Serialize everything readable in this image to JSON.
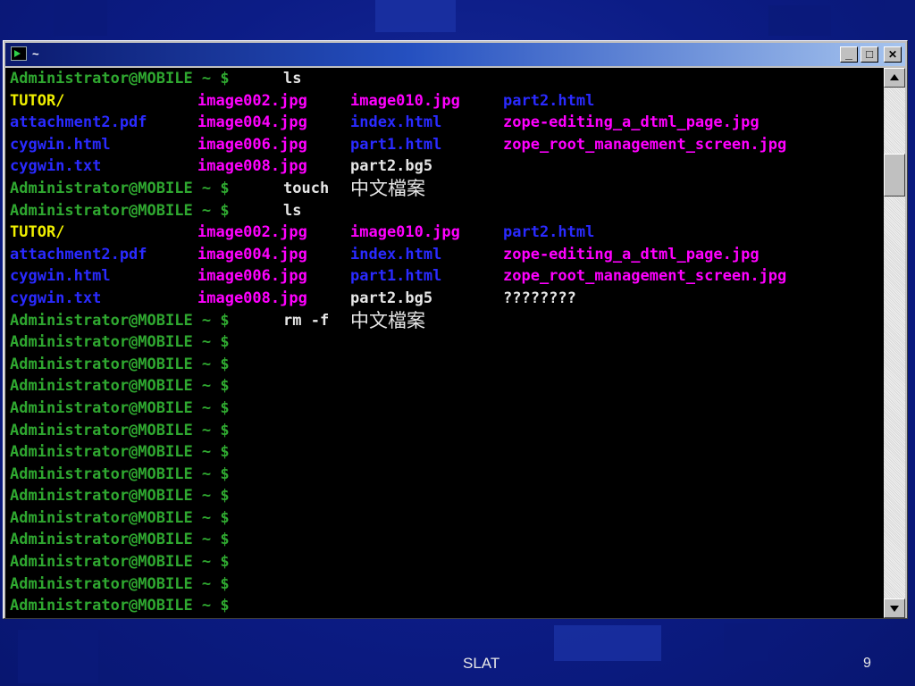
{
  "window": {
    "title": "~",
    "minimize": "_",
    "maximize": "□",
    "close": "✕"
  },
  "icons": {
    "app": "terminal-icon",
    "minimize": "minimize-icon",
    "maximize": "maximize-icon",
    "close": "close-icon",
    "scroll_up": "arrow-up-icon",
    "scroll_down": "arrow-down-icon"
  },
  "colors": {
    "prompt": "#2fa830",
    "directory": "#f0f000",
    "image": "#ff00ff",
    "text_file": "#2a2aff",
    "plain": "#e6e6e6"
  },
  "terminal": {
    "lines": [
      [
        {
          "t": "Administrator@MOBILE ~ $",
          "c": "prompt",
          "col": 0
        },
        {
          "t": "ls",
          "c": "plain",
          "col": 1
        }
      ],
      [
        {
          "t": "TUTOR/",
          "c": "directory",
          "col": 0
        },
        {
          "t": "image002.jpg",
          "c": "image",
          "col": 1
        },
        {
          "t": "image010.jpg",
          "c": "image",
          "col": 2
        },
        {
          "t": "part2.html",
          "c": "text_file",
          "col": 3
        }
      ],
      [
        {
          "t": "attachment2.pdf",
          "c": "text_file",
          "col": 0
        },
        {
          "t": "image004.jpg",
          "c": "image",
          "col": 1
        },
        {
          "t": "index.html",
          "c": "text_file",
          "col": 2
        },
        {
          "t": "zope-editing_a_dtml_page.jpg",
          "c": "image",
          "col": 3
        }
      ],
      [
        {
          "t": "cygwin.html",
          "c": "text_file",
          "col": 0
        },
        {
          "t": "image006.jpg",
          "c": "image",
          "col": 1
        },
        {
          "t": "part1.html",
          "c": "text_file",
          "col": 2
        },
        {
          "t": "zope_root_management_screen.jpg",
          "c": "image",
          "col": 3
        }
      ],
      [
        {
          "t": "cygwin.txt",
          "c": "text_file",
          "col": 0
        },
        {
          "t": "image008.jpg",
          "c": "image",
          "col": 1
        },
        {
          "t": "part2.bg5",
          "c": "plain",
          "col": 2
        }
      ],
      [
        {
          "t": "Administrator@MOBILE ~ $",
          "c": "prompt",
          "col": 0
        },
        {
          "t": "touch",
          "c": "plain",
          "col": 1
        },
        {
          "t": "中文檔案",
          "c": "plain",
          "col": 2,
          "cjk": true
        }
      ],
      [
        {
          "t": "Administrator@MOBILE ~ $",
          "c": "prompt",
          "col": 0
        },
        {
          "t": "ls",
          "c": "plain",
          "col": 1
        }
      ],
      [
        {
          "t": "TUTOR/",
          "c": "directory",
          "col": 0
        },
        {
          "t": "image002.jpg",
          "c": "image",
          "col": 1
        },
        {
          "t": "image010.jpg",
          "c": "image",
          "col": 2
        },
        {
          "t": "part2.html",
          "c": "text_file",
          "col": 3
        }
      ],
      [
        {
          "t": "attachment2.pdf",
          "c": "text_file",
          "col": 0
        },
        {
          "t": "image004.jpg",
          "c": "image",
          "col": 1
        },
        {
          "t": "index.html",
          "c": "text_file",
          "col": 2
        },
        {
          "t": "zope-editing_a_dtml_page.jpg",
          "c": "image",
          "col": 3
        }
      ],
      [
        {
          "t": "cygwin.html",
          "c": "text_file",
          "col": 0
        },
        {
          "t": "image006.jpg",
          "c": "image",
          "col": 1
        },
        {
          "t": "part1.html",
          "c": "text_file",
          "col": 2
        },
        {
          "t": "zope_root_management_screen.jpg",
          "c": "image",
          "col": 3
        }
      ],
      [
        {
          "t": "cygwin.txt",
          "c": "text_file",
          "col": 0
        },
        {
          "t": "image008.jpg",
          "c": "image",
          "col": 1
        },
        {
          "t": "part2.bg5",
          "c": "plain",
          "col": 2
        },
        {
          "t": "????????",
          "c": "plain",
          "col": 3
        }
      ],
      [
        {
          "t": "Administrator@MOBILE ~ $",
          "c": "prompt",
          "col": 0
        },
        {
          "t": "rm -f",
          "c": "plain",
          "col": 1
        },
        {
          "t": "中文檔案",
          "c": "plain",
          "col": 2,
          "cjk": true
        }
      ],
      [
        {
          "t": "Administrator@MOBILE ~ $",
          "c": "prompt",
          "col": 0
        }
      ],
      [
        {
          "t": "Administrator@MOBILE ~ $",
          "c": "prompt",
          "col": 0
        }
      ],
      [
        {
          "t": "Administrator@MOBILE ~ $",
          "c": "prompt",
          "col": 0
        }
      ],
      [
        {
          "t": "Administrator@MOBILE ~ $",
          "c": "prompt",
          "col": 0
        }
      ],
      [
        {
          "t": "Administrator@MOBILE ~ $",
          "c": "prompt",
          "col": 0
        }
      ],
      [
        {
          "t": "Administrator@MOBILE ~ $",
          "c": "prompt",
          "col": 0
        }
      ],
      [
        {
          "t": "Administrator@MOBILE ~ $",
          "c": "prompt",
          "col": 0
        }
      ],
      [
        {
          "t": "Administrator@MOBILE ~ $",
          "c": "prompt",
          "col": 0
        }
      ],
      [
        {
          "t": "Administrator@MOBILE ~ $",
          "c": "prompt",
          "col": 0
        }
      ],
      [
        {
          "t": "Administrator@MOBILE ~ $",
          "c": "prompt",
          "col": 0
        }
      ],
      [
        {
          "t": "Administrator@MOBILE ~ $",
          "c": "prompt",
          "col": 0
        }
      ],
      [
        {
          "t": "Administrator@MOBILE ~ $",
          "c": "prompt",
          "col": 0
        }
      ],
      [
        {
          "t": "Administrator@MOBILE ~ $",
          "c": "prompt",
          "col": 0
        }
      ]
    ]
  },
  "footer": {
    "label": "SLAT",
    "page": "9"
  }
}
